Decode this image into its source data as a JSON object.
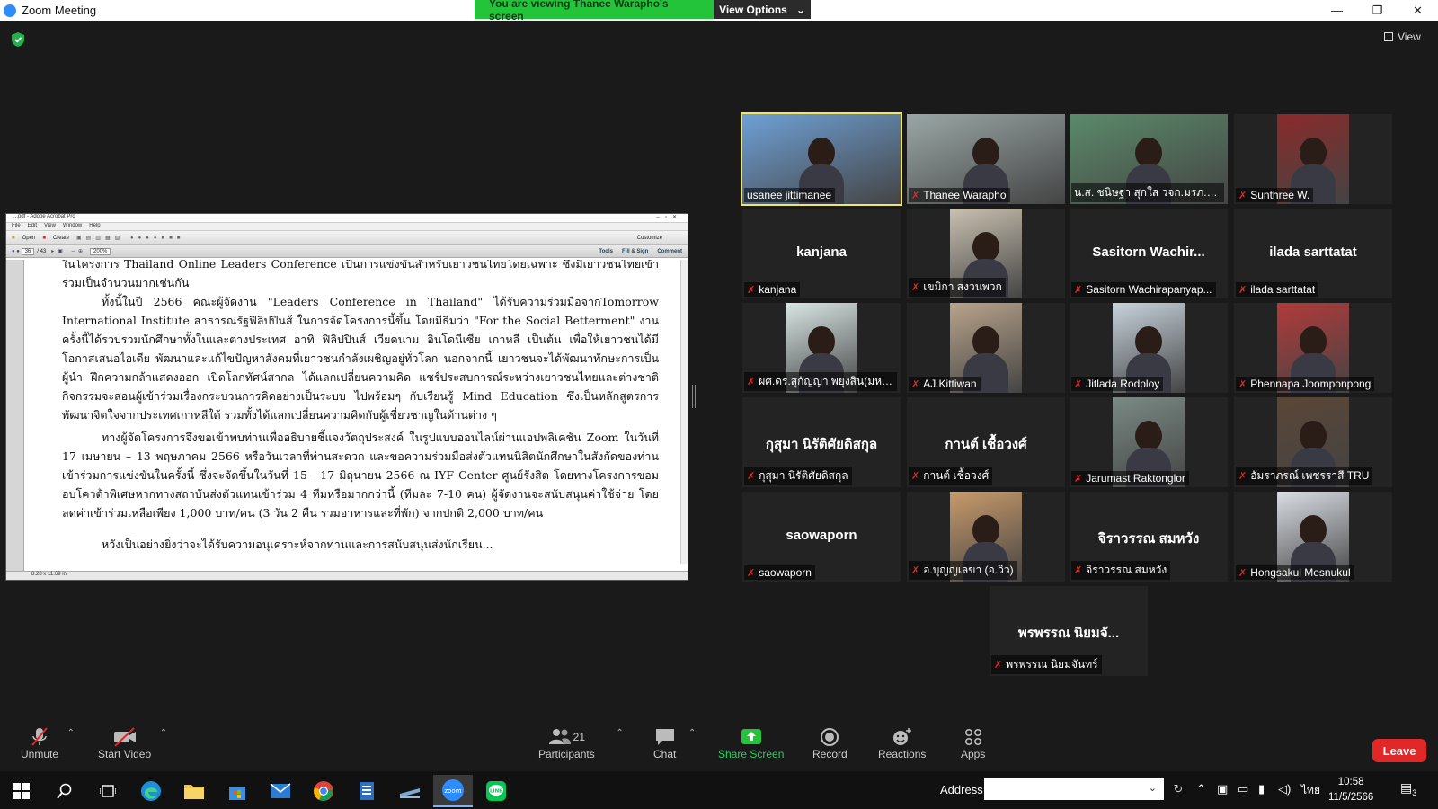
{
  "window": {
    "title": "Zoom Meeting",
    "minimize": "—",
    "maximize": "❐",
    "close": "✕"
  },
  "banner": {
    "viewing_text": "You are viewing Thanee Warapho's screen",
    "view_options": "View Options"
  },
  "view_button": "View",
  "shared_screen": {
    "app_title": "...pdf - Adobe Acrobat Pro",
    "menu": [
      "File",
      "Edit",
      "View",
      "Window",
      "Help"
    ],
    "toolbar_open": "Open",
    "toolbar_create": "Create",
    "toolbar_customize": "Customize",
    "page_current": "36",
    "page_total": "/ 43",
    "zoom": "200%",
    "tools": "Tools",
    "fill_sign": "Fill & Sign",
    "comment": "Comment",
    "status": "8.28 x 11.69 in",
    "paragraphs": [
      "ในโครงการ Thailand Online Leaders Conference เป็นการแข่งขันสำหรับเยาวชนไทยโดยเฉพาะ ซึ่งมีเยาวชนไทยเข้าร่วมเป็นจำนวนมากเช่นกัน",
      "ทั้งนี้ในปี 2566 คณะผู้จัดงาน \"Leaders Conference in Thailand\" ได้รับความร่วมมือจากTomorrow International Institute สาธารณรัฐฟิลิปปินส์ ในการจัดโครงการนี้ขึ้น โดยมีธีมว่า \"For the Social Betterment\" งานครั้งนี้ได้รวบรวมนักศึกษาทั้งในและต่างประเทศ อาทิ ฟิลิปปินส์ เวียดนาม อินโดนีเซีย เกาหลี เป็นต้น เพื่อให้เยาวชนได้มีโอกาสเสนอไอเดีย พัฒนาและแก้ไขปัญหาสังคมที่เยาวชนกำลังเผชิญอยู่ทั่วโลก นอกจากนี้ เยาวชนจะได้พัฒนาทักษะการเป็นผู้นำ ฝึกความกล้าแสดงออก เปิดโลกทัศน์สากล ได้แลกเปลี่ยนความคิด แชร์ประสบการณ์ระหว่างเยาวชนไทยและต่างชาติ กิจกรรมจะสอนผู้เข้าร่วมเรื่องกระบวนการคิดอย่างเป็นระบบ ไปพร้อมๆ กับเรียนรู้ Mind Education ซึ่งเป็นหลักสูตรการพัฒนาจิตใจจากประเทศเกาหลีใต้ รวมทั้งได้แลกเปลี่ยนความคิดกับผู้เชี่ยวชาญในด้านต่าง ๆ",
      "ทางผู้จัดโครงการจึงขอเข้าพบท่านเพื่ออธิบายชี้แจงวัตถุประสงค์ ในรูปแบบออนไลน์ผ่านแอปพลิเคชัน Zoom ในวันที่ 17 เมษายน – 13 พฤษภาคม 2566 หรือวันเวลาที่ท่านสะดวก และขอความร่วมมือส่งตัวแทนนิสิตนักศึกษาในสังกัดของท่านเข้าร่วมการแข่งขันในครั้งนี้ ซึ่งจะจัดขึ้นในวันที่ 15 - 17 มิถุนายน 2566 ณ IYF Center ศูนย์รังสิต โดยทางโครงการขอมอบโควต้าพิเศษหากทางสถาบันส่งตัวแทนเข้าร่วม 4 ทีมหรือมากกว่านี้ (ทีมละ 7-10 คน) ผู้จัดงานจะสนับสนุนค่าใช้จ่าย โดยลดค่าเข้าร่วมเหลือเพียง 1,000 บาท/คน (3 วัน 2 คืน รวมอาหารและที่พัก) จากปกติ 2,000 บาท/คน",
      "หวังเป็นอย่างยิ่งว่าจะได้รับความอนุเคราะห์จากท่านและการสนับสนุนส่งนักเรียน..."
    ]
  },
  "participants": [
    {
      "name": "usanee jittimanee",
      "big": "",
      "photo": true,
      "muted": false,
      "active": true,
      "bg": "#6fa0d6"
    },
    {
      "name": "Thanee Warapho",
      "big": "",
      "photo": true,
      "muted": true,
      "active": false,
      "bg": "#9aa7a6"
    },
    {
      "name": "น.ส. ชนิษฐา สุกใส วจก.มรภ.เพช...",
      "big": "",
      "photo": true,
      "muted": false,
      "active": false,
      "bg": "#5b8a6a"
    },
    {
      "name": "Sunthree W.",
      "big": "",
      "photo": true,
      "muted": true,
      "active": false,
      "bg": "#8a2a2a"
    },
    {
      "name": "kanjana",
      "big": "kanjana",
      "photo": false,
      "muted": true,
      "active": false,
      "bg": ""
    },
    {
      "name": "เขมิกา สงวนพวก",
      "big": "",
      "photo": true,
      "muted": true,
      "active": false,
      "bg": "#c9c0b0"
    },
    {
      "name": "Sasitorn Wachirapanyap...",
      "big": "Sasitorn  Wachir...",
      "photo": false,
      "muted": true,
      "active": false,
      "bg": ""
    },
    {
      "name": "ilada sarttatat",
      "big": "ilada sarttatat",
      "photo": false,
      "muted": true,
      "active": false,
      "bg": ""
    },
    {
      "name": "ผศ.ดร.สุกัญญา พยุงสิน(มหา...",
      "big": "",
      "photo": true,
      "muted": true,
      "active": false,
      "bg": "#d8e6e4"
    },
    {
      "name": "AJ.Kittiwan",
      "big": "",
      "photo": true,
      "muted": true,
      "active": false,
      "bg": "#b8a38a"
    },
    {
      "name": "Jitlada Rodploy",
      "big": "",
      "photo": true,
      "muted": true,
      "active": false,
      "bg": "#c7d3dc"
    },
    {
      "name": "Phennapa Joomponpong",
      "big": "",
      "photo": true,
      "muted": true,
      "active": false,
      "bg": "#b23a3a"
    },
    {
      "name": "กุสุมา นิรัติศัยดิสกุล",
      "big": "กุสุมา นิรัติศัยดิสกุล",
      "photo": false,
      "muted": true,
      "active": false,
      "bg": ""
    },
    {
      "name": "กานต์ เชื้อวงศ์",
      "big": "กานต์ เชื้อวงศ์",
      "photo": false,
      "muted": true,
      "active": false,
      "bg": ""
    },
    {
      "name": "Jarumast Raktonglor",
      "big": "",
      "photo": true,
      "muted": true,
      "active": false,
      "bg": "#7a8a84"
    },
    {
      "name": "อัมราภรณ์ เพชรราสี TRU",
      "big": "",
      "photo": true,
      "muted": true,
      "active": false,
      "bg": "#5a4636"
    },
    {
      "name": "saowaporn",
      "big": "saowaporn",
      "photo": false,
      "muted": true,
      "active": false,
      "bg": ""
    },
    {
      "name": "อ.บุญญเลขา (อ.วิว)",
      "big": "",
      "photo": true,
      "muted": true,
      "active": false,
      "bg": "#c89a6a"
    },
    {
      "name": "จิราวรรณ สมหวัง",
      "big": "จิราวรรณ สมหวัง",
      "photo": false,
      "muted": true,
      "active": false,
      "bg": ""
    },
    {
      "name": "Hongsakul Mesnukul",
      "big": "",
      "photo": true,
      "muted": true,
      "active": false,
      "bg": "#d9dde3"
    },
    {
      "name": "พรพรรณ  นิยมจันทร์",
      "big": "พรพรรณ  นิยมจั...",
      "photo": false,
      "muted": true,
      "active": false,
      "bg": ""
    }
  ],
  "toolbar": {
    "unmute": "Unmute",
    "start_video": "Start Video",
    "participants": "Participants",
    "participants_count": "21",
    "chat": "Chat",
    "share_screen": "Share Screen",
    "record": "Record",
    "reactions": "Reactions",
    "apps": "Apps",
    "leave": "Leave"
  },
  "taskbar": {
    "address_label": "Address",
    "language": "ไทย",
    "time": "10:58",
    "date": "11/5/2566",
    "notification_count": "3"
  }
}
